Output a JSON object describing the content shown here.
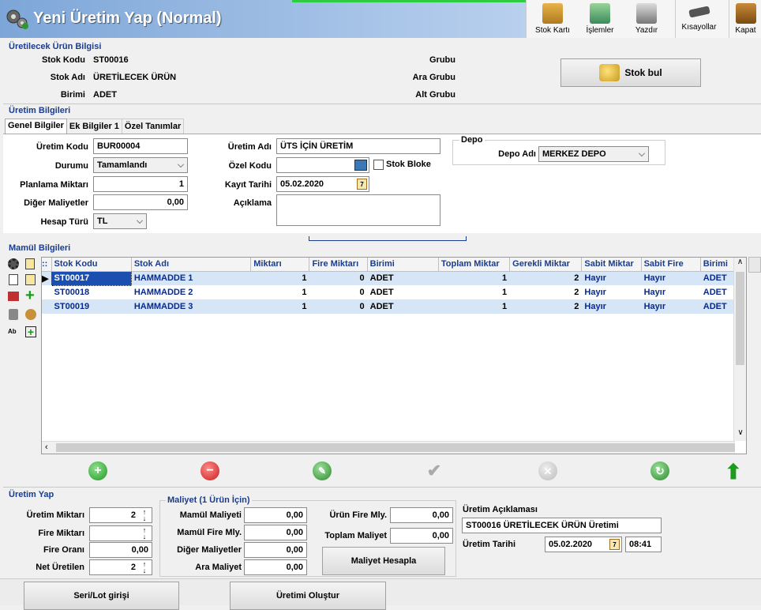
{
  "window": {
    "title": "Yeni Üretim Yap (Normal)"
  },
  "toolbar": {
    "items": [
      {
        "label": "Stok Kartı",
        "icon": "stock-card-icon"
      },
      {
        "label": "İşlemler",
        "icon": "operations-icon"
      },
      {
        "label": "Yazdır",
        "icon": "printer-icon"
      },
      {
        "label": "Kısayollar",
        "icon": "keyboard-icon"
      },
      {
        "label": "Kapat",
        "icon": "close-door-icon"
      }
    ]
  },
  "product": {
    "section_title": "Üretilecek Ürün Bilgisi",
    "stok_kodu_label": "Stok Kodu",
    "stok_kodu": "ST00016",
    "stok_adi_label": "Stok Adı",
    "stok_adi": "ÜRETİLECEK ÜRÜN",
    "birimi_label": "Birimi",
    "birimi": "ADET",
    "grubu_label": "Grubu",
    "ara_grubu_label": "Ara Grubu",
    "alt_grubu_label": "Alt Grubu",
    "stok_bul": "Stok bul"
  },
  "production": {
    "section_title": "Üretim Bilgileri",
    "tabs": [
      "Genel Bilgiler",
      "Ek Bilgiler 1",
      "Özel Tanımlar"
    ],
    "uretim_kodu_label": "Üretim Kodu",
    "uretim_kodu": "BUR00004",
    "durumu_label": "Durumu",
    "durumu": "Tamamlandı",
    "planlama_label": "Planlama Miktarı",
    "planlama": "1",
    "diger_label": "Diğer Maliyetler",
    "diger": "0,00",
    "hesap_label": "Hesap Türü",
    "hesap": "TL",
    "uretim_adi_label": "Üretim Adı",
    "uretim_adi": "ÜTS İÇİN ÜRETİM",
    "ozel_kodu_label": "Özel Kodu",
    "ozel_kodu": "",
    "stok_bloke": "Stok Bloke",
    "kayit_label": "Kayıt Tarihi",
    "kayit": "05.02.2020",
    "aciklama_label": "Açıklama",
    "aciklama": "",
    "depo_title": "Depo",
    "depo_adi_label": "Depo Adı",
    "depo_adi": "MERKEZ DEPO"
  },
  "mamul": {
    "section_title": "Mamül Bilgileri",
    "columns": [
      "Stok Kodu",
      "Stok Adı",
      "Miktarı",
      "Fire Miktarı",
      "Birimi",
      "Toplam Miktar",
      "Gerekli Miktar",
      "Sabit Miktar",
      "Sabit Fire",
      "Birimi"
    ],
    "rows": [
      {
        "stok_kodu": "ST00017",
        "stok_adi": "HAMMADDE 1",
        "miktari": "1",
        "fire": "0",
        "birimi": "ADET",
        "toplam": "1",
        "gerekli": "2",
        "sabit_miktar": "Hayır",
        "sabit_fire": "Hayır",
        "birimi2": "ADET"
      },
      {
        "stok_kodu": "ST00018",
        "stok_adi": "HAMMADDE 2",
        "miktari": "1",
        "fire": "0",
        "birimi": "ADET",
        "toplam": "1",
        "gerekli": "2",
        "sabit_miktar": "Hayır",
        "sabit_fire": "Hayır",
        "birimi2": "ADET"
      },
      {
        "stok_kodu": "ST00019",
        "stok_adi": "HAMMADDE 3",
        "miktari": "1",
        "fire": "0",
        "birimi": "ADET",
        "toplam": "1",
        "gerekli": "2",
        "sabit_miktar": "Hayır",
        "sabit_fire": "Hayır",
        "birimi2": "ADET"
      }
    ]
  },
  "uretim_yap": {
    "section_title": "Üretim Yap",
    "uretim_miktari_label": "Üretim Miktarı",
    "uretim_miktari": "2",
    "fire_miktari_label": "Fire Miktarı",
    "fire_miktari": "",
    "fire_orani_label": "Fire Oranı",
    "fire_orani": "0,00",
    "net_label": "Net Üretilen",
    "net": "2"
  },
  "maliyet": {
    "section_title": "Maliyet (1 Ürün İçin)",
    "mamul_label": "Mamül Maliyeti",
    "mamul": "0,00",
    "mamul_fire_label": "Mamül Fire Mly.",
    "mamul_fire": "0,00",
    "diger_label": "Diğer Maliyetler",
    "diger": "0,00",
    "ara_label": "Ara Maliyet",
    "ara": "0,00",
    "urun_fire_label": "Ürün Fire Mly.",
    "urun_fire": "0,00",
    "toplam_label": "Toplam Maliyet",
    "toplam": "0,00",
    "hesapla": "Maliyet Hesapla"
  },
  "aciklama": {
    "section_title": "Üretim Açıklaması",
    "text": "ST00016 ÜRETİLECEK ÜRÜN Üretimi",
    "tarih_label": "Üretim Tarihi",
    "tarih": "05.02.2020",
    "saat": "08:41"
  },
  "footer": {
    "seri_lot": "Seri/Lot girişi",
    "olustur": "Üretimi Oluştur"
  }
}
